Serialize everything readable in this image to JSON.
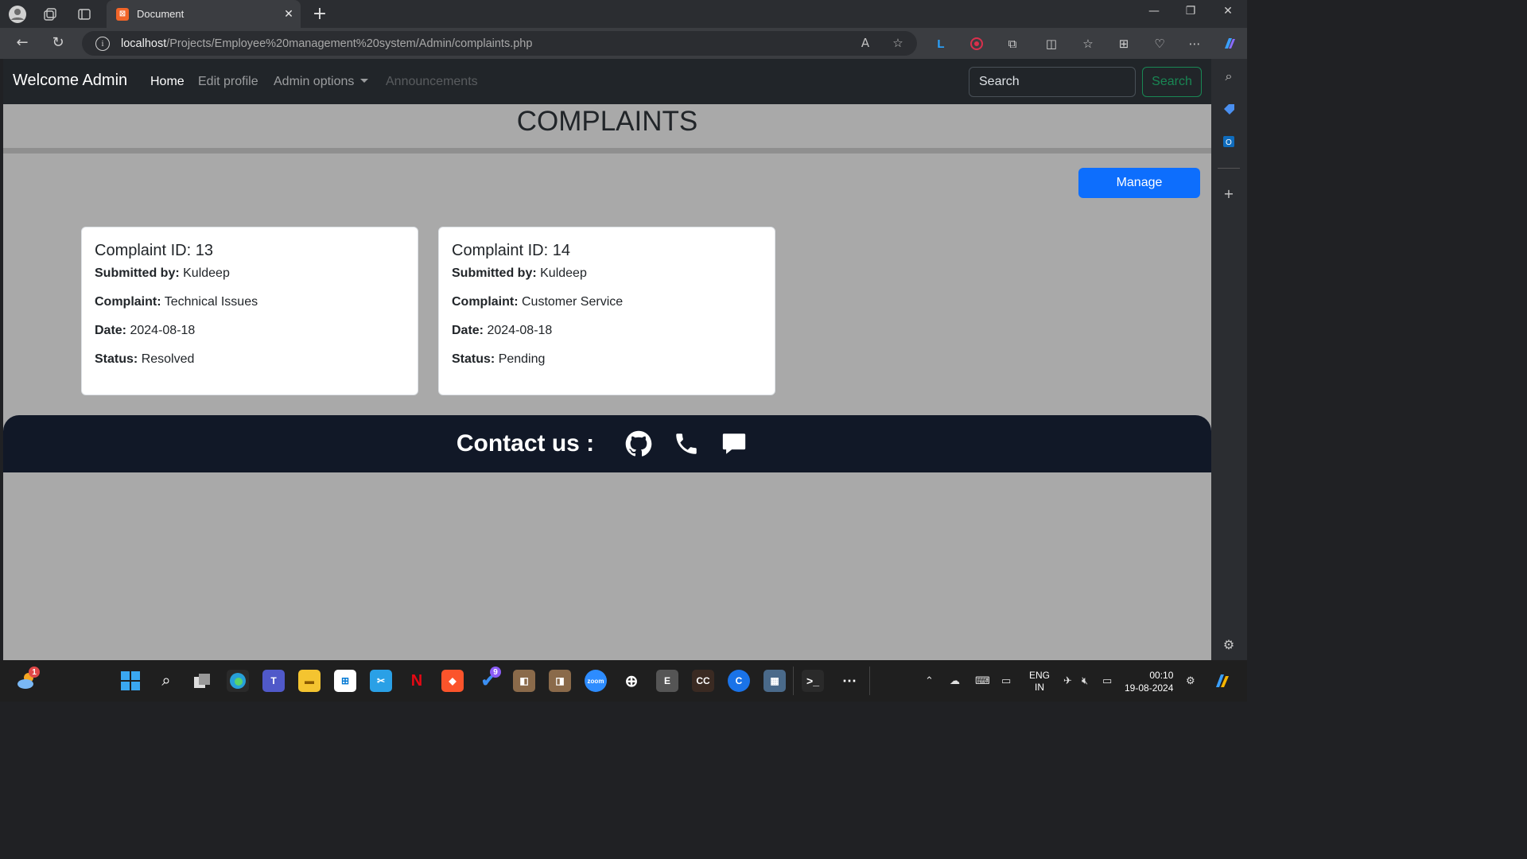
{
  "browser": {
    "tab_title": "Document",
    "url_host": "localhost",
    "url_path": "/Projects/Employee%20management%20system/Admin/complaints.php"
  },
  "navbar": {
    "brand": "Welcome Admin",
    "links": [
      "Home",
      "Edit profile",
      "Admin options",
      "Announcements"
    ],
    "search_placeholder": "Search",
    "search_button": "Search"
  },
  "page": {
    "heading": "COMPLAINTS",
    "manage_button": "Manage"
  },
  "complaints": [
    {
      "title": "Complaint ID: 13",
      "submitted_label": "Submitted by:",
      "submitted_by": "Kuldeep",
      "complaint_label": "Complaint:",
      "complaint": "Technical Issues",
      "date_label": "Date:",
      "date": "2024-08-18",
      "status_label": "Status:",
      "status": "Resolved"
    },
    {
      "title": "Complaint ID: 14",
      "submitted_label": "Submitted by:",
      "submitted_by": "Kuldeep",
      "complaint_label": "Complaint:",
      "complaint": "Customer Service",
      "date_label": "Date:",
      "date": "2024-08-18",
      "status_label": "Status:",
      "status": "Pending"
    }
  ],
  "footer": {
    "contact": "Contact us :",
    "icons": [
      "github-icon",
      "phone-icon",
      "chat-icon"
    ]
  },
  "taskbar": {
    "weather_badge": "1",
    "todo_badge": "9",
    "lang_top": "ENG",
    "lang_bottom": "IN",
    "time": "00:10",
    "date": "19-08-2024"
  },
  "colors": {
    "page_bg": "#a9a9a9",
    "navbar_bg": "#212529",
    "primary": "#0d6efd",
    "success": "#198754",
    "footer_bg": "#111827"
  }
}
